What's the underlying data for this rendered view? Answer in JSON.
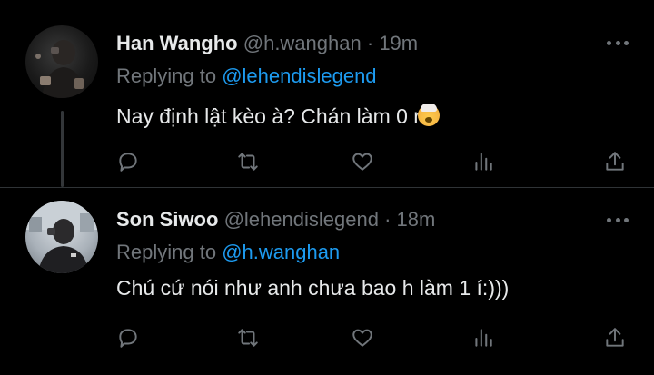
{
  "tweets": [
    {
      "name": "Han Wangho",
      "handle": "@h.wanghan",
      "separator": "·",
      "time": "19m",
      "replying_prefix": "Replying to ",
      "replying_to": "@lehendislegend",
      "text": "Nay định lật kèo à? Chán làm 0 r",
      "emoji": "exploding-head"
    },
    {
      "name": "Son Siwoo",
      "handle": "@lehendislegend",
      "separator": "·",
      "time": "18m",
      "replying_prefix": "Replying to ",
      "replying_to": "@h.wanghan",
      "text": "Chú cứ nói như anh chưa bao h làm 1 í:)))"
    }
  ],
  "icons": [
    "more-icon",
    "reply-icon",
    "retweet-icon",
    "like-icon",
    "views-icon",
    "share-icon"
  ],
  "colors": {
    "background": "#000000",
    "text": "#e7e9ea",
    "muted": "#71767b",
    "link": "#1d9bf0",
    "divider": "#2f3336"
  }
}
